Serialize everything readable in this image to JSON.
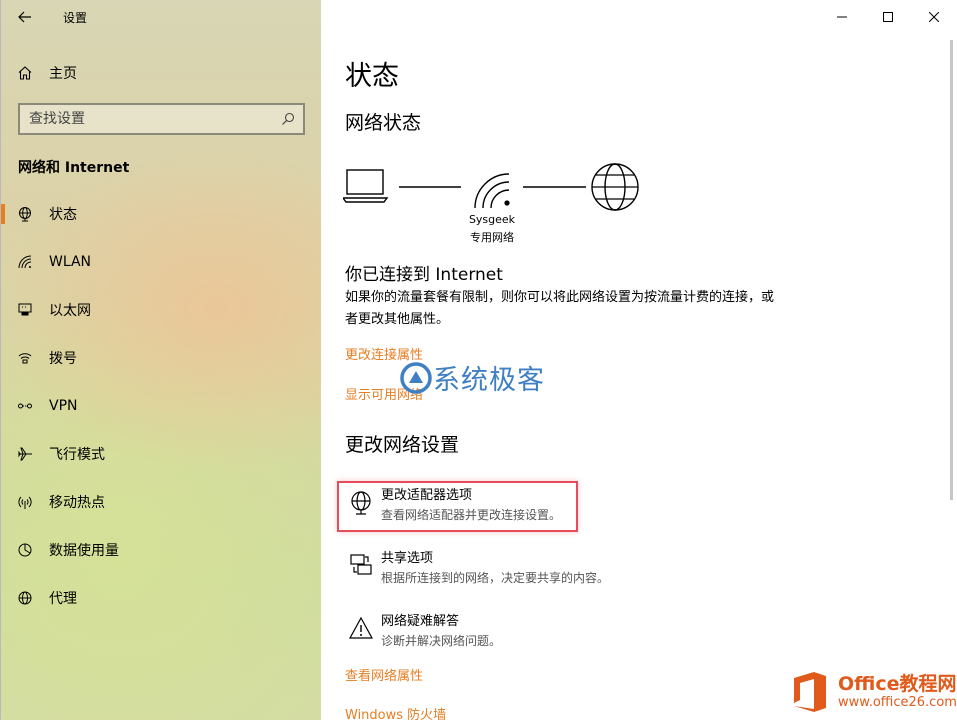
{
  "window": {
    "title": "设置"
  },
  "sidebar": {
    "home_label": "主页",
    "search_placeholder": "查找设置",
    "section_heading": "网络和 Internet",
    "items": [
      {
        "label": "状态",
        "icon": "globe-icon",
        "active": true
      },
      {
        "label": "WLAN",
        "icon": "wifi-icon"
      },
      {
        "label": "以太网",
        "icon": "ethernet-icon"
      },
      {
        "label": "拨号",
        "icon": "dialup-icon"
      },
      {
        "label": "VPN",
        "icon": "vpn-icon"
      },
      {
        "label": "飞行模式",
        "icon": "airplane-icon"
      },
      {
        "label": "移动热点",
        "icon": "hotspot-icon"
      },
      {
        "label": "数据使用量",
        "icon": "data-usage-icon"
      },
      {
        "label": "代理",
        "icon": "proxy-globe-icon"
      }
    ]
  },
  "main": {
    "page_title": "状态",
    "network_status_heading": "网络状态",
    "network_name": "Sysgeek",
    "network_type": "专用网络",
    "connected_title": "你已连接到 Internet",
    "connected_desc": "如果你的流量套餐有限制，则你可以将此网络设置为按流量计费的连接，或者更改其他属性。",
    "link_change_props": "更改连接属性",
    "link_show_networks": "显示可用网络",
    "change_settings_heading": "更改网络设置",
    "options": [
      {
        "title": "更改适配器选项",
        "desc": "查看网络适配器并更改连接设置。",
        "icon": "adapter-icon"
      },
      {
        "title": "共享选项",
        "desc": "根据所连接到的网络，决定要共享的内容。",
        "icon": "sharing-icon"
      },
      {
        "title": "网络疑难解答",
        "desc": "诊断并解决网络问题。",
        "icon": "warning-icon"
      }
    ],
    "link_view_props": "查看网络属性",
    "link_firewall": "Windows 防火墙"
  },
  "watermark": {
    "text": "系统极客"
  },
  "office_logo": {
    "brand": "Office教程网",
    "url": "www.office26.com"
  },
  "colors": {
    "accent": "#e67e22",
    "highlight": "#e64d5a",
    "watermark": "#3f7fc4"
  }
}
